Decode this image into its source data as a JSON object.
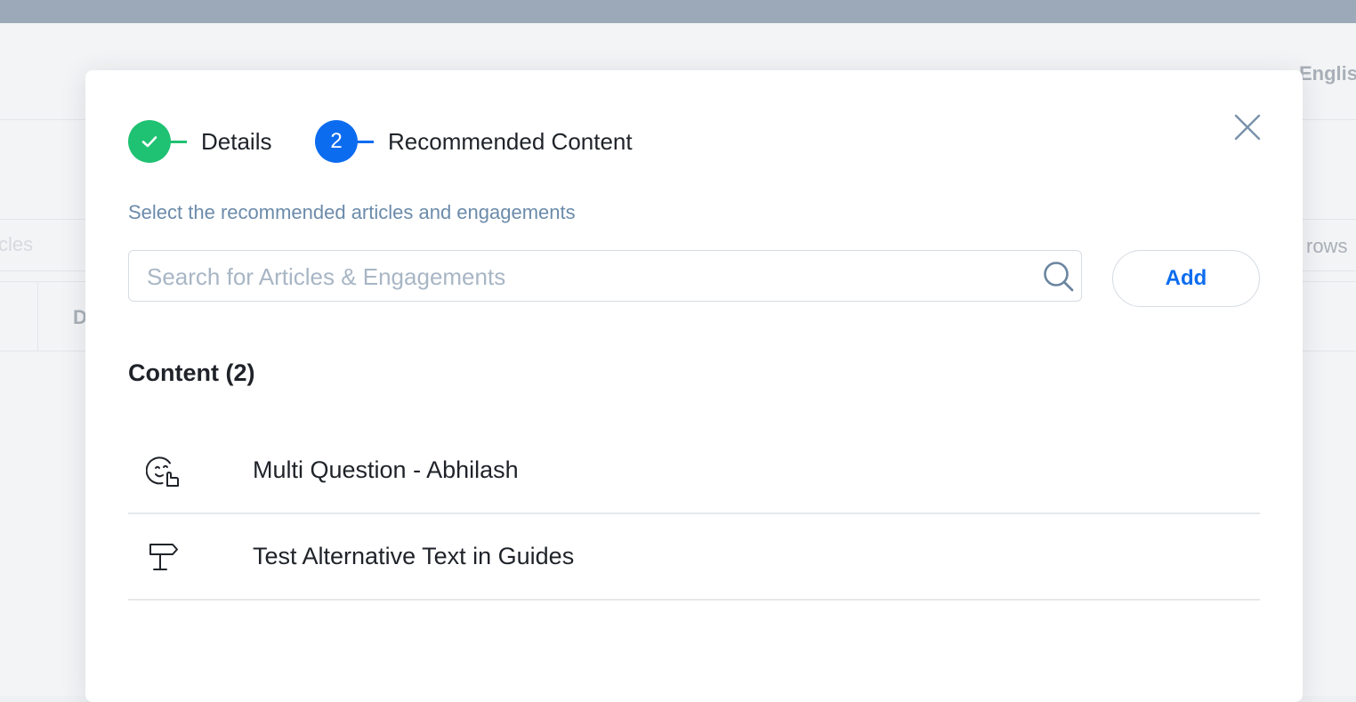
{
  "background": {
    "language": "Englis",
    "tab_fragment": "cles",
    "rows_fragment": "rows",
    "column_fragment": "D"
  },
  "modal": {
    "steps": [
      {
        "number": "1",
        "label": "Details",
        "status": "complete"
      },
      {
        "number": "2",
        "label": "Recommended Content",
        "status": "active"
      }
    ],
    "subtitle": "Select the recommended articles and engagements",
    "search": {
      "placeholder": "Search for Articles & Engagements",
      "value": ""
    },
    "add_label": "Add",
    "content_heading": "Content (2)",
    "items": [
      {
        "title": "Multi Question - Abhilash",
        "icon": "engagement-survey-icon"
      },
      {
        "title": "Test Alternative Text in Guides",
        "icon": "guide-signpost-icon"
      }
    ]
  },
  "colors": {
    "complete": "#1fc272",
    "active": "#0c6cf0",
    "subtitle": "#6b8bab"
  }
}
